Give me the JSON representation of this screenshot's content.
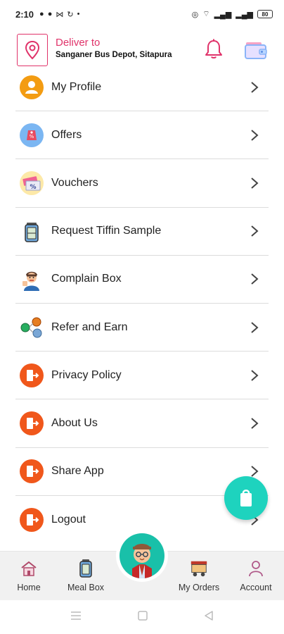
{
  "status_bar": {
    "time": "2:10",
    "battery": "80"
  },
  "header": {
    "deliver_label": "Deliver to",
    "address": "Sanganer Bus Depot, Sitapura"
  },
  "menu": {
    "items": [
      {
        "label": "My Profile",
        "icon": "profile-icon"
      },
      {
        "label": "Offers",
        "icon": "offers-tag-icon"
      },
      {
        "label": "Vouchers",
        "icon": "voucher-icon"
      },
      {
        "label": "Request Tiffin Sample",
        "icon": "tiffin-icon"
      },
      {
        "label": "Complain Box",
        "icon": "complain-person-icon"
      },
      {
        "label": "Refer and Earn",
        "icon": "refer-coins-icon"
      },
      {
        "label": "Privacy Policy",
        "icon": "exit-door-icon"
      },
      {
        "label": "About Us",
        "icon": "exit-door-icon"
      },
      {
        "label": "Share App",
        "icon": "exit-door-icon"
      },
      {
        "label": "Logout",
        "icon": "exit-door-icon"
      }
    ]
  },
  "bottom_nav": {
    "home": "Home",
    "meal_box": "Meal Box",
    "my_orders": "My Orders",
    "account": "Account"
  },
  "colors": {
    "accent": "#e0336a",
    "orange": "#f0571b",
    "teal": "#1ed3be"
  }
}
